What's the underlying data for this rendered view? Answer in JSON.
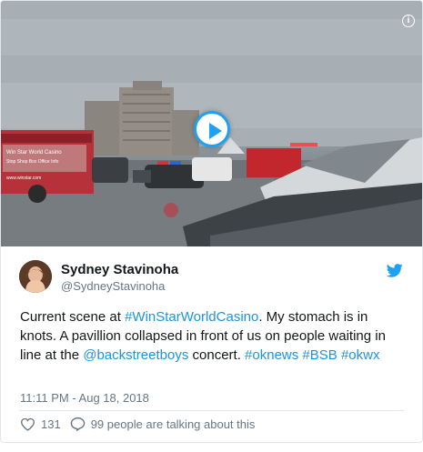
{
  "media": {
    "play_icon": "play-icon",
    "info_icon": "info-icon",
    "info_glyph": "i",
    "bus_sign_lines": [
      "Win Star World Casino",
      "Stop  Shop  Box Office  Info",
      "www.winstar.com"
    ]
  },
  "author": {
    "display_name": "Sydney Stavinoha",
    "handle": "@SydneyStavinoha",
    "avatar_icon": "avatar"
  },
  "brand": {
    "icon": "twitter-bird-icon",
    "color": "#1da1f2"
  },
  "tweet": {
    "seg1": "Current scene at ",
    "tag1": "#WinStarWorldCasino",
    "seg2": ". My stomach is in knots. A pavillion collapsed in front of us on people waiting in line at the ",
    "mention1": "@backstreetboys",
    "seg3": " concert. ",
    "tag2": "#oknews",
    "seg4": " ",
    "tag3": "#BSB",
    "seg5": " ",
    "tag4": "#okwx",
    "link_color": "#1b95e0"
  },
  "timestamp": "11:11 PM - Aug 18, 2018",
  "actions": {
    "like_icon": "heart-icon",
    "like_count": "131",
    "reply_icon": "speech-bubble-icon",
    "talking_text": "99 people are talking about this"
  }
}
